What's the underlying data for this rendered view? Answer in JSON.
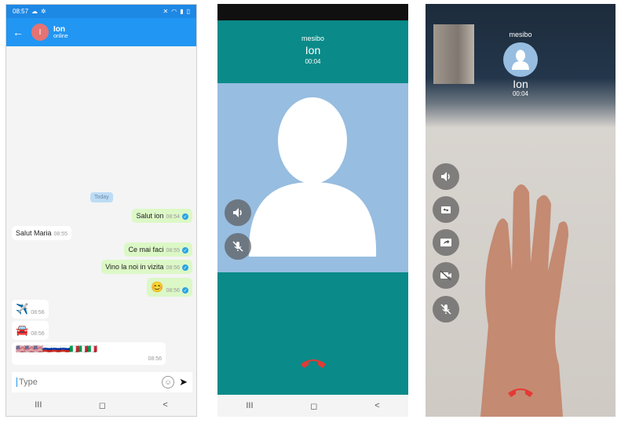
{
  "chat": {
    "status_time": "08:57",
    "contact_initial": "I",
    "contact_name": "Ion",
    "contact_status": "online",
    "day_label": "Today",
    "messages": [
      {
        "text": "Salut ion",
        "time": "08:54",
        "dir": "out"
      },
      {
        "text": "Salut Maria",
        "time": "08:55",
        "dir": "in"
      },
      {
        "text": "Ce mai faci",
        "time": "08:55",
        "dir": "out"
      },
      {
        "text": "Vino la noi in vizita",
        "time": "08:56",
        "dir": "out"
      },
      {
        "text": "😊",
        "time": "08:56",
        "dir": "out"
      },
      {
        "text": "✈️",
        "time": "08:56",
        "dir": "in"
      },
      {
        "text": "🚘",
        "time": "08:56",
        "dir": "in"
      },
      {
        "text": "🇺🇸🇺🇸🇺🇸🇷🇺🇷🇺🇷🇺🇮🇹🇮🇹🇮🇹",
        "time": "08:56",
        "dir": "in"
      }
    ],
    "input_placeholder": "Type",
    "nav": [
      "III",
      "◻",
      "<"
    ]
  },
  "voice_call": {
    "app_name": "mesibo",
    "contact_name": "Ion",
    "duration": "00:04",
    "nav": [
      "III",
      "◻",
      "<"
    ]
  },
  "video_call": {
    "app_name": "mesibo",
    "contact_name": "Ion",
    "duration": "00:04"
  },
  "colors": {
    "appbar": "#2196f3",
    "call_bg": "#0a8a88",
    "avatar_bg": "#97bde0",
    "hangup": "#e53935",
    "bubble_out": "#dcf8c6"
  }
}
